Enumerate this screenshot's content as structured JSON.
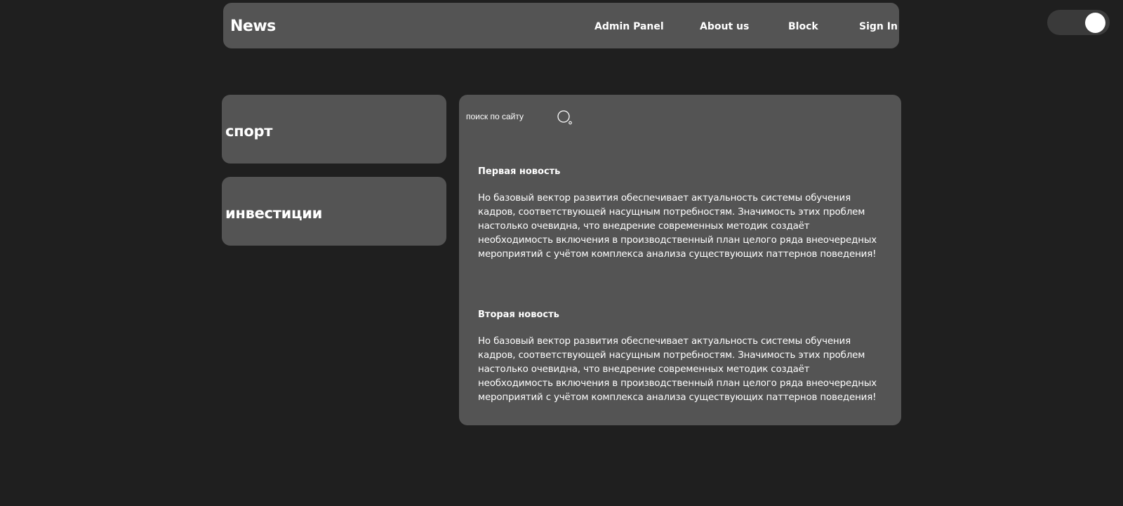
{
  "header": {
    "logo": "News",
    "nav": [
      "Admin Panel",
      "About us",
      "Block",
      "Sign In"
    ]
  },
  "theme_toggle": {
    "state": "on"
  },
  "categories": [
    "спорт",
    "инвестиции"
  ],
  "search": {
    "placeholder": "поиск по сайту",
    "icon": "search-icon"
  },
  "news": [
    {
      "title": "Первая новость",
      "text": "Но базовый вектор развития обеспечивает актуальность системы обучения кадров, соответствующей насущным потребностям. Значимость этих проблем настолько очевидна, что внедрение современных методик создаёт необходимость включения в производственный план целого ряда внеочередных мероприятий с учётом комплекса анализа существующих паттернов поведения!"
    },
    {
      "title": "Вторая новость",
      "text": "Но базовый вектор развития обеспечивает актуальность системы обучения кадров, соответствующей насущным потребностям. Значимость этих проблем настолько очевидна, что внедрение современных методик создаёт необходимость включения в производственный план целого ряда внеочередных мероприятий с учётом комплекса анализа существующих паттернов поведения!"
    }
  ],
  "colors": {
    "background": "#1f1f1f",
    "panel": "#545454",
    "toggle_track": "#3a3a3a",
    "text": "#ffffff"
  }
}
